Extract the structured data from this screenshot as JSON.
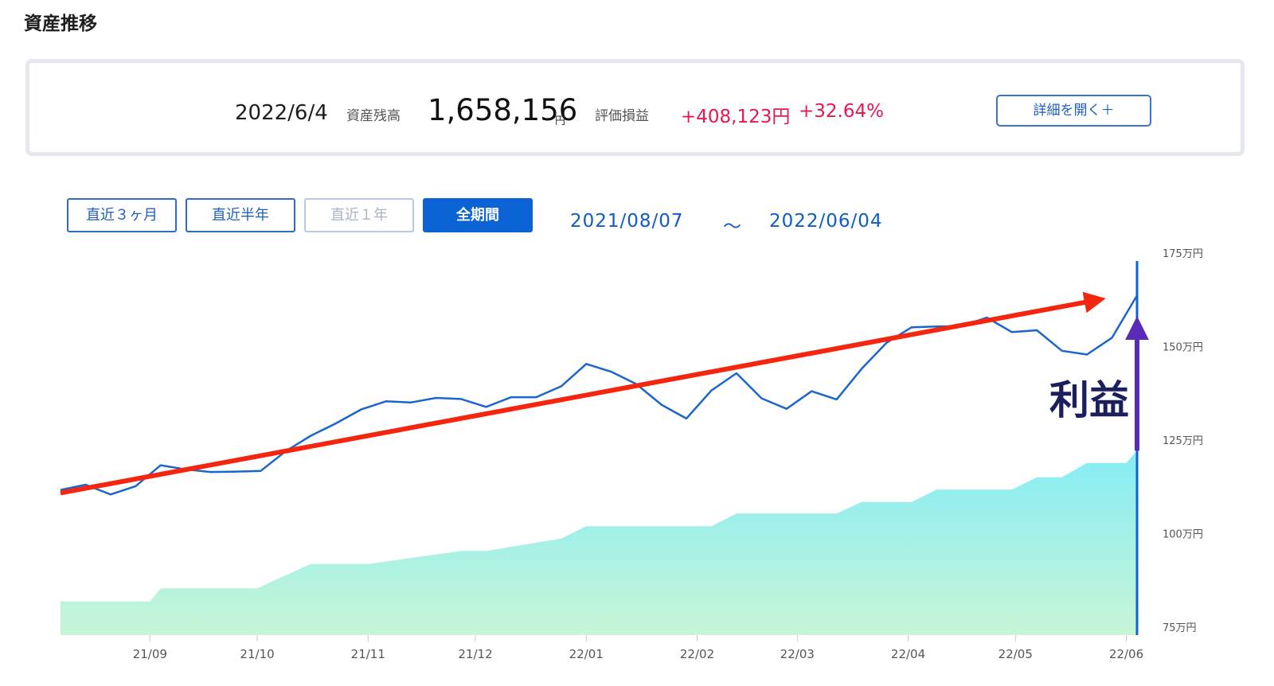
{
  "page": {
    "title": "資産推移"
  },
  "summary": {
    "date": "2022/6/4",
    "balance_label": "資産残高",
    "balance": "1,658,156",
    "balance_unit": "円",
    "pl_label": "評価損益",
    "pl_amount": "+408,123円",
    "pl_percent": "+32.64%",
    "detail_button": "詳細を開く＋"
  },
  "periods": [
    {
      "label": "直近３ヶ月",
      "state": "normal"
    },
    {
      "label": "直近半年",
      "state": "normal"
    },
    {
      "label": "直近１年",
      "state": "disabled"
    },
    {
      "label": "全期間",
      "state": "active"
    }
  ],
  "range": {
    "start": "2021/08/07",
    "separator": "〜",
    "end": "2022/06/04"
  },
  "annotation": "利益",
  "colors": {
    "accent": "#0c63d4",
    "gain": "#e8174f",
    "asset_line": "#1a66cc",
    "trend_arrow": "#f5260f",
    "profit_arrow": "#5a2ab8",
    "area_top": "#85ecf5",
    "area_bottom": "#c7f5d6"
  },
  "chart_data": {
    "type": "line",
    "y_unit": "万円",
    "yticks": [
      "175万円",
      "150万円",
      "125万円",
      "100万円",
      "75万円"
    ],
    "ytick_values": [
      175,
      150,
      125,
      100,
      75
    ],
    "ylim": [
      75,
      175
    ],
    "xticks": [
      "21/09",
      "21/10",
      "21/11",
      "21/12",
      "22/01",
      "22/02",
      "22/03",
      "22/04",
      "22/05",
      "22/06"
    ],
    "xtick_dates": [
      "2021-09-01",
      "2021-10-01",
      "2021-11-01",
      "2021-12-01",
      "2022-01-01",
      "2022-02-01",
      "2022-03-01",
      "2022-04-01",
      "2022-05-01",
      "2022-06-01"
    ],
    "series": [
      {
        "kind": "line",
        "x": [
          "2021-08-07",
          "2021-08-14",
          "2021-08-21",
          "2021-08-28",
          "2021-09-04",
          "2021-09-11",
          "2021-09-18",
          "2021-09-25",
          "2021-10-02",
          "2021-10-09",
          "2021-10-16",
          "2021-10-23",
          "2021-10-30",
          "2021-11-06",
          "2021-11-13",
          "2021-11-20",
          "2021-11-27",
          "2021-12-04",
          "2021-12-11",
          "2021-12-18",
          "2021-12-25",
          "2022-01-01",
          "2022-01-08",
          "2022-01-15",
          "2022-01-22",
          "2022-01-29",
          "2022-02-05",
          "2022-02-12",
          "2022-02-19",
          "2022-02-26",
          "2022-03-05",
          "2022-03-12",
          "2022-03-19",
          "2022-03-26",
          "2022-04-02",
          "2022-04-09",
          "2022-04-16",
          "2022-04-23",
          "2022-04-30",
          "2022-05-07",
          "2022-05-14",
          "2022-05-21",
          "2022-05-28",
          "2022-06-04"
        ],
        "values": [
          113.8,
          115.2,
          112.6,
          114.8,
          120.4,
          119.3,
          118.6,
          118.7,
          118.9,
          124.2,
          128.3,
          131.6,
          135.3,
          137.5,
          137.2,
          138.4,
          138.1,
          136,
          138.6,
          138.6,
          141.5,
          147.5,
          145.4,
          142.1,
          136.6,
          132.9,
          140.4,
          145,
          138.3,
          135.5,
          140.2,
          138,
          146.2,
          153.2,
          157.3,
          157.5,
          157.6,
          159.9,
          156,
          156.5,
          151,
          150,
          154.5,
          165.8
        ]
      },
      {
        "kind": "area",
        "x": [
          "2021-08-07",
          "2021-09-01",
          "2021-09-04",
          "2021-10-01",
          "2021-10-09",
          "2021-10-16",
          "2021-11-01",
          "2021-11-27",
          "2021-12-04",
          "2021-12-25",
          "2022-01-01",
          "2022-02-05",
          "2022-02-12",
          "2022-03-12",
          "2022-03-19",
          "2022-04-02",
          "2022-04-09",
          "2022-04-30",
          "2022-05-07",
          "2022-05-14",
          "2022-05-21",
          "2022-06-01",
          "2022-06-04"
        ],
        "values": [
          84,
          84,
          87.5,
          87.5,
          91,
          94,
          94,
          97.5,
          97.5,
          100.8,
          104.1,
          104.1,
          107.5,
          107.5,
          110.6,
          110.6,
          113.9,
          113.9,
          117.2,
          117.2,
          121,
          121,
          124.3
        ]
      }
    ],
    "annotations": [
      {
        "kind": "trend-arrow",
        "from": {
          "x": "2021-08-07",
          "y": 113
        },
        "to": {
          "x": "2022-06-04",
          "y": 165
        }
      },
      {
        "kind": "profit-arrow",
        "label": "利益",
        "from_y": 124.3,
        "to_y": 165.8
      }
    ]
  }
}
